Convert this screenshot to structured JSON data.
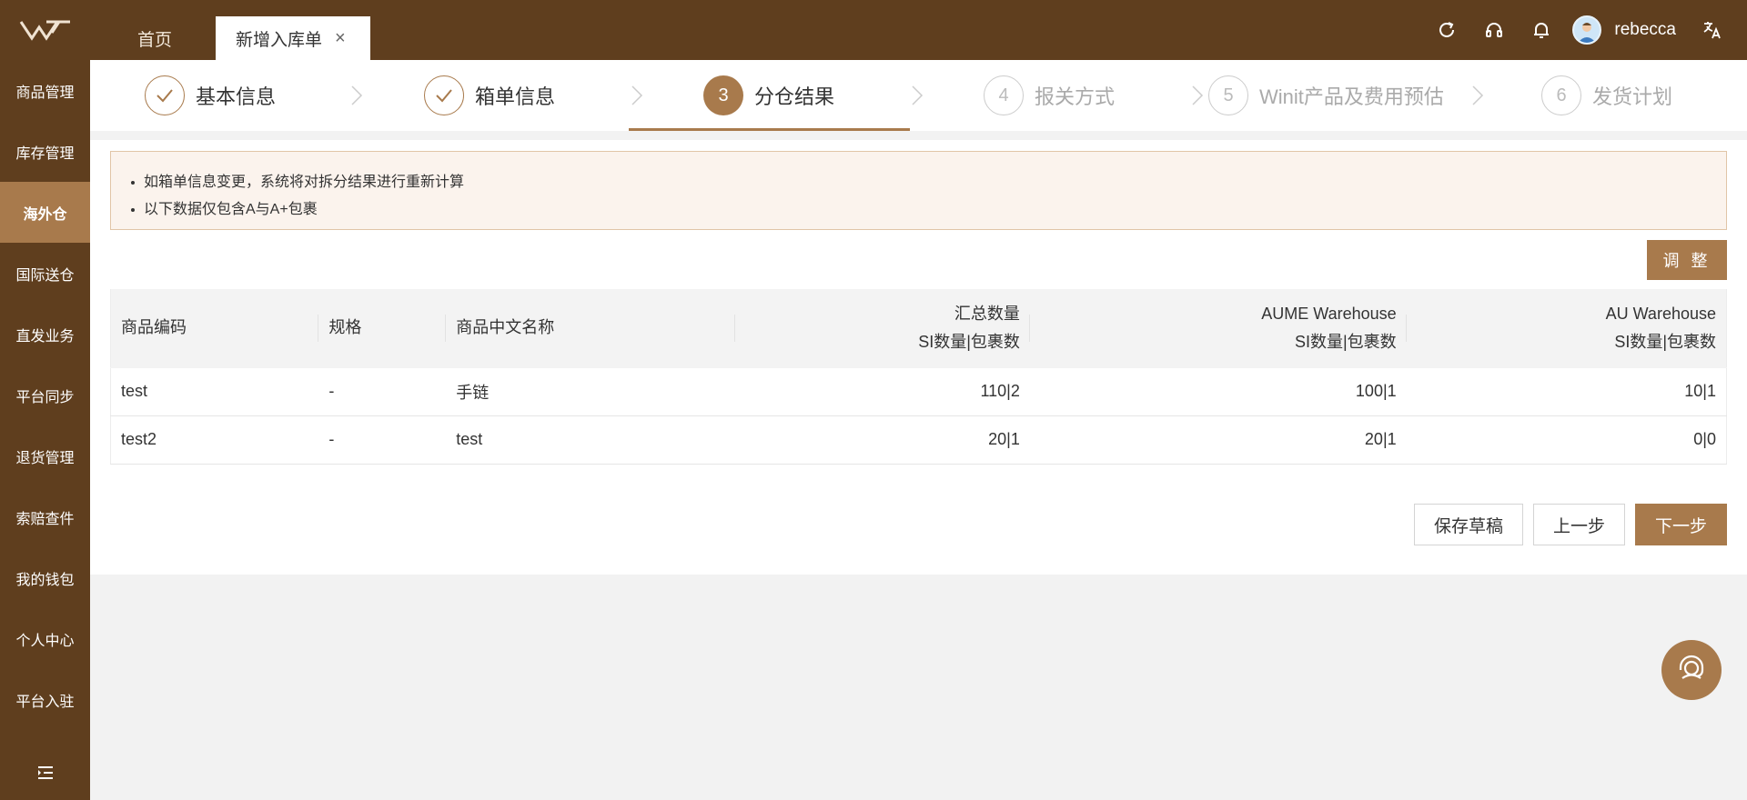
{
  "colors": {
    "brand_dark": "#5f3e1e",
    "accent": "#a87a4c",
    "notice_bg": "#fbf3ed"
  },
  "topbar": {
    "logo_icon": "brand-logo",
    "tabs": [
      {
        "label": "首页"
      },
      {
        "label": "新增入库单",
        "closable": true
      }
    ],
    "icons": [
      "refresh-icon",
      "headset-icon",
      "bell-icon",
      "translate-icon"
    ],
    "user": {
      "name": "rebecca"
    }
  },
  "sidebar": {
    "items": [
      {
        "label": "商品管理"
      },
      {
        "label": "库存管理"
      },
      {
        "label": "海外仓",
        "active": true
      },
      {
        "label": "国际送仓"
      },
      {
        "label": "直发业务"
      },
      {
        "label": "平台同步"
      },
      {
        "label": "退货管理"
      },
      {
        "label": "索赔查件"
      },
      {
        "label": "我的钱包"
      },
      {
        "label": "个人中心"
      },
      {
        "label": "平台入驻"
      }
    ],
    "collapse_icon": "menu-collapse-icon"
  },
  "steps": [
    {
      "index": "1",
      "label": "基本信息",
      "status": "done"
    },
    {
      "index": "2",
      "label": "箱单信息",
      "status": "done"
    },
    {
      "index": "3",
      "label": "分仓结果",
      "status": "current"
    },
    {
      "index": "4",
      "label": "报关方式",
      "status": "pending"
    },
    {
      "index": "5",
      "label": "Winit产品及费用预估",
      "status": "pending"
    },
    {
      "index": "6",
      "label": "发货计划",
      "status": "pending"
    }
  ],
  "notice": {
    "lines": [
      "如箱单信息变更，系统将对拆分结果进行重新计算",
      "以下数据仅包含A与A+包裹"
    ]
  },
  "adjust_button": "调 整",
  "table": {
    "headers": {
      "code": "商品编码",
      "spec": "规格",
      "name": "商品中文名称",
      "total_line1": "汇总数量",
      "total_line2": "SI数量|包裹数",
      "wh1_line1": "AUME Warehouse",
      "wh1_line2": "SI数量|包裹数",
      "wh2_line1": "AU Warehouse",
      "wh2_line2": "SI数量|包裹数"
    },
    "rows": [
      {
        "code": "test",
        "spec": "-",
        "name": "手链",
        "total": "110|2",
        "wh1": "100|1",
        "wh2": "10|1"
      },
      {
        "code": "test2",
        "spec": "-",
        "name": "test",
        "total": "20|1",
        "wh1": "20|1",
        "wh2": "0|0"
      }
    ]
  },
  "footer_buttons": {
    "save_draft": "保存草稿",
    "prev": "上一步",
    "next": "下一步"
  },
  "float_icon": "customer-service-icon"
}
